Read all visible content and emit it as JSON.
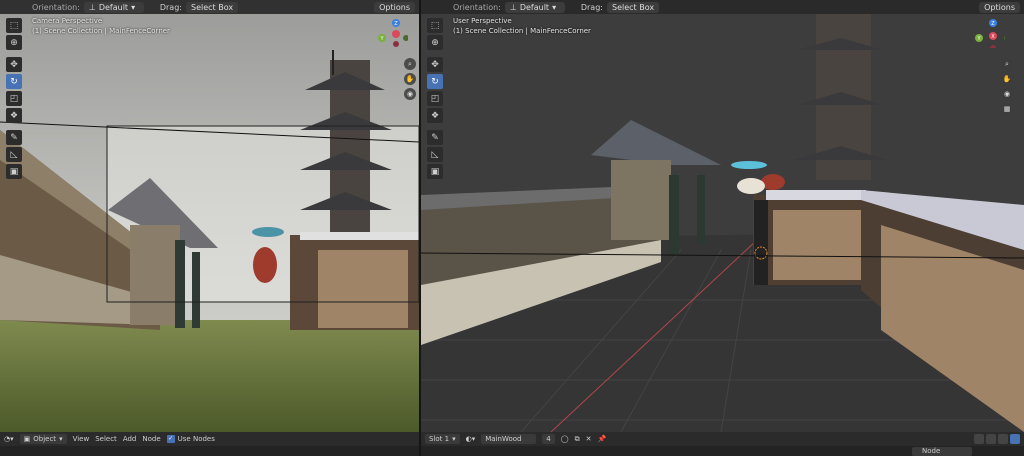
{
  "left_viewport": {
    "header": {
      "orientation_label": "Orientation:",
      "orientation_value": "Default",
      "drag_label": "Drag:",
      "drag_value": "Select Box",
      "options_label": "Options"
    },
    "perspective": "Camera Perspective",
    "collection": "(1) Scene Collection | MainFenceCorner"
  },
  "right_viewport": {
    "header": {
      "orientation_label": "Orientation:",
      "orientation_value": "Default",
      "drag_label": "Drag:",
      "drag_value": "Select Box",
      "options_label": "Options"
    },
    "perspective": "User Perspective",
    "collection": "(1) Scene Collection | MainFenceCorner"
  },
  "gizmo": {
    "x": "X",
    "y": "Y",
    "z": "Z"
  },
  "bottom_left": {
    "mode": "Object",
    "menu_view": "View",
    "menu_select": "Select",
    "menu_add": "Add",
    "menu_node": "Node",
    "use_nodes": "Use Nodes"
  },
  "bottom_right": {
    "slot": "Slot 1",
    "material": "MainWood",
    "user_count": "4"
  },
  "strip_right": {
    "node_tab": "Node"
  },
  "colors": {
    "accent": "#4772b3",
    "gizmo_x": "#d84a5a",
    "gizmo_y": "#7ab03c",
    "gizmo_z": "#3a7ee0"
  }
}
